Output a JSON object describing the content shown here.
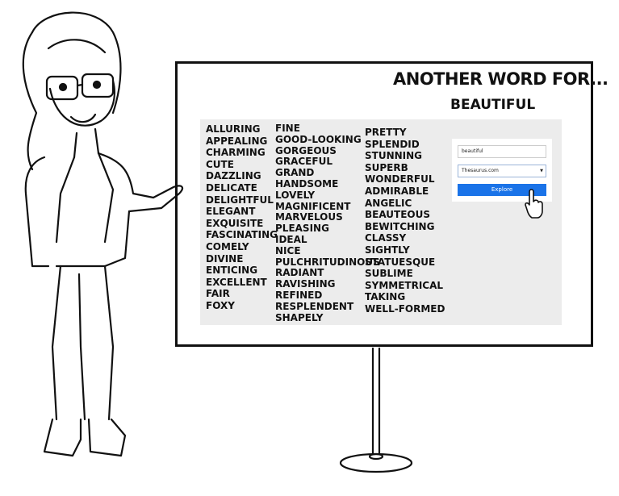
{
  "board": {
    "title": "ANOTHER WORD FOR...",
    "subtitle": "BEAUTIFUL",
    "columns": [
      [
        "ALLURING",
        "APPEALING",
        "CHARMING",
        "CUTE",
        "DAZZLING",
        "DELICATE",
        "DELIGHTFUL",
        "ELEGANT",
        "EXQUISITE",
        "FASCINATING",
        "COMELY",
        "DIVINE",
        "ENTICING",
        "EXCELLENT",
        "FAIR",
        "FOXY"
      ],
      [
        "FINE",
        "GOOD-LOOKING",
        "GORGEOUS",
        "GRACEFUL",
        "GRAND",
        "HANDSOME",
        "LOVELY",
        "MAGNIFICENT",
        "MARVELOUS",
        "PLEASING",
        "IDEAL",
        "NICE",
        "PULCHRITUDINOUS",
        "RADIANT",
        "RAVISHING",
        "REFINED",
        "RESPLENDENT",
        "SHAPELY"
      ],
      [
        "PRETTY",
        "SPLENDID",
        "STUNNING",
        "SUPERB",
        "WONDERFUL",
        "ADMIRABLE",
        "ANGELIC",
        "BEAUTEOUS",
        "BEWITCHING",
        "CLASSY",
        "SIGHTLY",
        "STATUESQUE",
        "SUBLIME",
        "SYMMETRICAL",
        "TAKING",
        "WELL-FORMED"
      ]
    ]
  },
  "form": {
    "search_value": "beautiful",
    "source_selected": "Thesaurus.com",
    "explore_label": "Explore",
    "button_color": "#1a73e8"
  },
  "icons": {
    "cursor": "hand-pointer-icon",
    "select": "dropdown-arrow-icon"
  }
}
